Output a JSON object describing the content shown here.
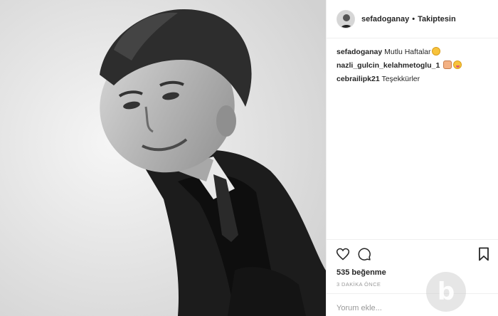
{
  "post": {
    "photo": {
      "description_icon": "portrait-photo"
    },
    "header": {
      "username": "sefadoganay",
      "separator": "•",
      "follow_status": "Takiptesin"
    },
    "comments": [
      {
        "user": "sefadoganay",
        "text": "Mutlu Haftalar",
        "emoji": [
          "smile"
        ]
      },
      {
        "user": "nazli_gulcin_kelahmetoglu_1",
        "text": "",
        "emoji": [
          "person",
          "tongue"
        ]
      },
      {
        "user": "cebrailipk21",
        "text": "Teşekkürler",
        "emoji": []
      }
    ],
    "actions": {
      "like_icon": "heart-icon",
      "comment_icon": "comment-icon",
      "save_icon": "bookmark-icon"
    },
    "likes": "535 beğenme",
    "time_ago": "3 DAKİKA ÖNCE",
    "comment_input": {
      "placeholder": "Yorum ekle..."
    },
    "watermark": "b"
  },
  "colors": {
    "text": "#262626",
    "muted": "#999999",
    "border": "#efefef"
  }
}
